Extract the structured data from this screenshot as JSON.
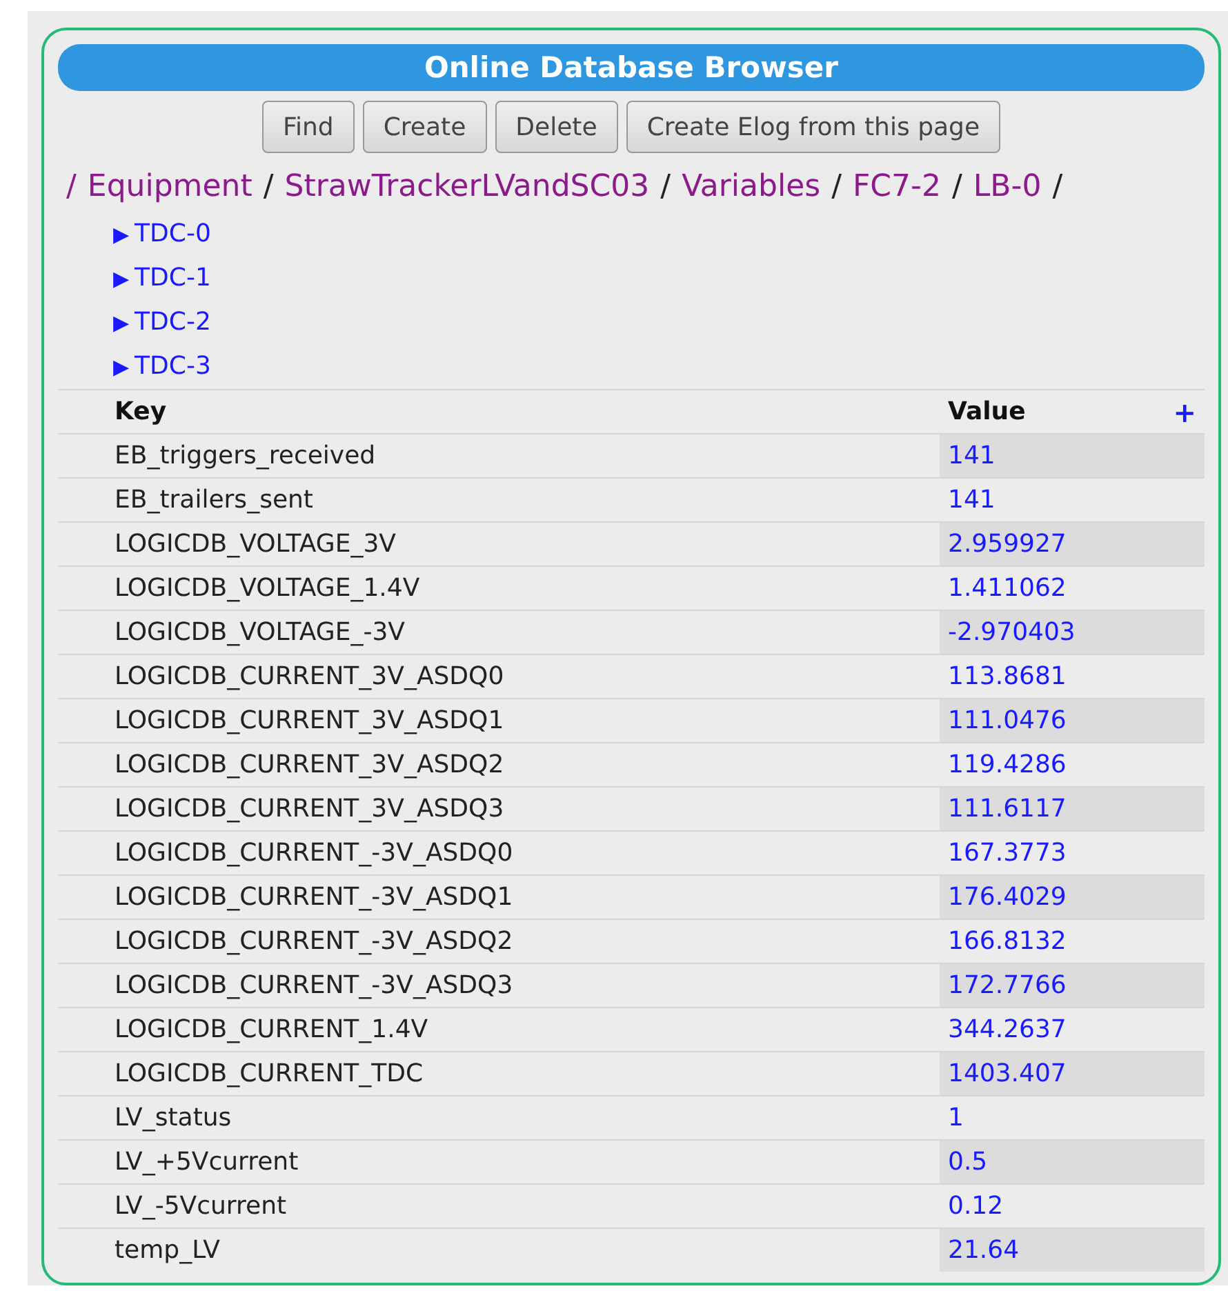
{
  "title": "Online Database Browser",
  "buttons": [
    "Find",
    "Create",
    "Delete",
    "Create Elog from this page"
  ],
  "breadcrumb": [
    {
      "kind": "link",
      "text": "/"
    },
    {
      "kind": "link",
      "text": "Equipment"
    },
    {
      "kind": "separator",
      "text": "/"
    },
    {
      "kind": "link",
      "text": "StrawTrackerLVandSC03"
    },
    {
      "kind": "separator",
      "text": "/"
    },
    {
      "kind": "link",
      "text": "Variables"
    },
    {
      "kind": "separator",
      "text": "/"
    },
    {
      "kind": "link",
      "text": "FC7-2"
    },
    {
      "kind": "separator",
      "text": "/"
    },
    {
      "kind": "link",
      "text": "LB-0"
    },
    {
      "kind": "separator",
      "text": "/"
    }
  ],
  "subdirs": [
    {
      "marker": "▶",
      "label": "TDC-0"
    },
    {
      "marker": "▶",
      "label": "TDC-1"
    },
    {
      "marker": "▶",
      "label": "TDC-2"
    },
    {
      "marker": "▶",
      "label": "TDC-3"
    }
  ],
  "table": {
    "columns": [
      "Key",
      "Value"
    ],
    "add": "+",
    "rows": [
      {
        "key": "EB_triggers_received",
        "value": "141"
      },
      {
        "key": "EB_trailers_sent",
        "value": "141"
      },
      {
        "key": "LOGICDB_VOLTAGE_3V",
        "value": "2.959927"
      },
      {
        "key": "LOGICDB_VOLTAGE_1.4V",
        "value": "1.411062"
      },
      {
        "key": "LOGICDB_VOLTAGE_-3V",
        "value": "-2.970403"
      },
      {
        "key": "LOGICDB_CURRENT_3V_ASDQ0",
        "value": "113.8681"
      },
      {
        "key": "LOGICDB_CURRENT_3V_ASDQ1",
        "value": "111.0476"
      },
      {
        "key": "LOGICDB_CURRENT_3V_ASDQ2",
        "value": "119.4286"
      },
      {
        "key": "LOGICDB_CURRENT_3V_ASDQ3",
        "value": "111.6117"
      },
      {
        "key": "LOGICDB_CURRENT_-3V_ASDQ0",
        "value": "167.3773"
      },
      {
        "key": "LOGICDB_CURRENT_-3V_ASDQ1",
        "value": "176.4029"
      },
      {
        "key": "LOGICDB_CURRENT_-3V_ASDQ2",
        "value": "166.8132"
      },
      {
        "key": "LOGICDB_CURRENT_-3V_ASDQ3",
        "value": "172.7766"
      },
      {
        "key": "LOGICDB_CURRENT_1.4V",
        "value": "344.2637"
      },
      {
        "key": "LOGICDB_CURRENT_TDC",
        "value": "1403.407"
      },
      {
        "key": "LV_status",
        "value": "1"
      },
      {
        "key": "LV_+5Vcurrent",
        "value": "0.5"
      },
      {
        "key": "LV_-5Vcurrent",
        "value": "0.12"
      },
      {
        "key": "temp_LV",
        "value": "21.64"
      }
    ]
  }
}
